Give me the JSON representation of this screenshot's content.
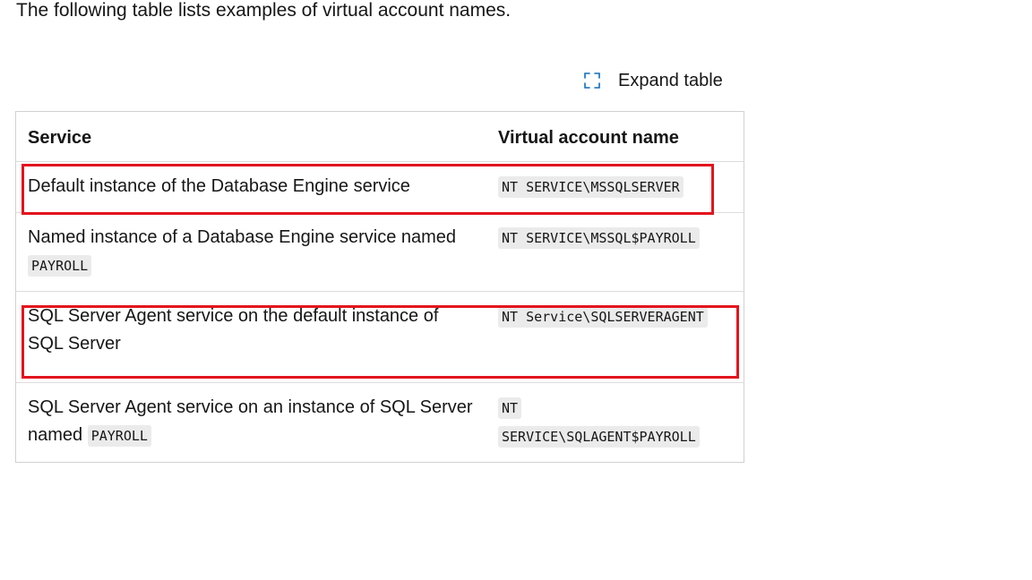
{
  "intro_text": "The following table lists examples of virtual account names.",
  "expand_label": "Expand table",
  "table": {
    "headers": [
      "Service",
      "Virtual account name"
    ],
    "rows": [
      {
        "service": "Default instance of the Database Engine service",
        "account": "NT SERVICE\\MSSQLSERVER"
      },
      {
        "service": "Named instance of a Database Engine service named",
        "service_code": "PAYROLL",
        "account": "NT SERVICE\\MSSQL$PAYROLL"
      },
      {
        "service": "SQL Server Agent service on the default instance of SQL Server",
        "account": "NT Service\\SQLSERVERAGENT"
      },
      {
        "service": "SQL Server Agent service on an instance of SQL Server named",
        "service_code": "PAYROLL",
        "account_line1": "NT",
        "account_line2": "SERVICE\\SQLAGENT$PAYROLL"
      }
    ]
  },
  "colors": {
    "highlight": "#e3141e",
    "border": "#d1d1d1",
    "code_bg": "#ebebeb"
  }
}
